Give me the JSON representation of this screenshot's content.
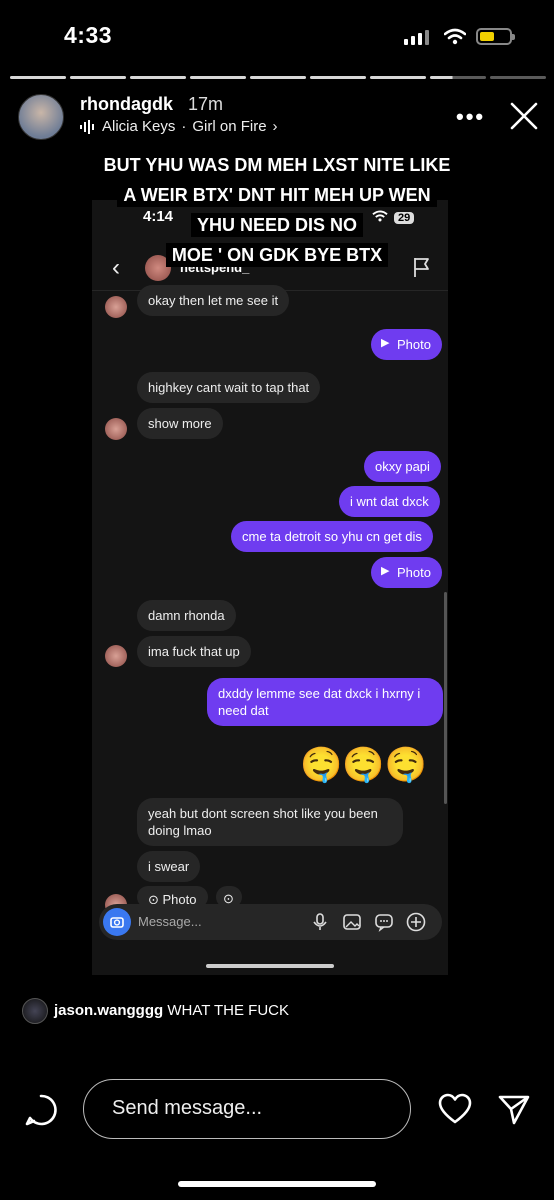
{
  "status": {
    "time": "4:33"
  },
  "story": {
    "username": "rhondagdk",
    "time_ago": "17m",
    "music_artist": "Alicia Keys",
    "music_sep": "·",
    "music_title": "Girl on Fire",
    "caption_lines": [
      "BUT YHU WAS DM MEH LXST NITE LIKE",
      "A WEIR BTX' DNT HIT MEH UP WEN",
      "YHU NEED DIS NO",
      "MOE ' ON GDK BYE BTX"
    ]
  },
  "inner_screenshot": {
    "status_time": "4:14",
    "battery": "29",
    "thread_name": "nettspend_",
    "messages": [
      {
        "side": "in",
        "text": "okay then let me see it"
      },
      {
        "side": "out",
        "text": "Photo",
        "type": "photo"
      },
      {
        "side": "in",
        "text": "highkey cant wait to tap that"
      },
      {
        "side": "in",
        "text": "show more"
      },
      {
        "side": "out",
        "text": "okxy papi"
      },
      {
        "side": "out",
        "text": "i wnt dat dxck"
      },
      {
        "side": "out",
        "text": "cme ta detroit so yhu cn get dis"
      },
      {
        "side": "out",
        "text": "Photo",
        "type": "photo"
      },
      {
        "side": "in",
        "text": "damn rhonda"
      },
      {
        "side": "in",
        "text": "ima fuck that up"
      },
      {
        "side": "out",
        "text": "dxddy lemme see dat dxck i hxrny i need dat"
      },
      {
        "side": "out",
        "text": "🤤🤤🤤",
        "type": "emoji"
      },
      {
        "side": "in",
        "text": "yeah but dont screen shot like you been doing lmao"
      },
      {
        "side": "in",
        "text": "i swear"
      },
      {
        "side": "in",
        "text": "Photo",
        "type": "photo"
      }
    ],
    "composer_placeholder": "Message..."
  },
  "comment": {
    "user": "jason.wangggg",
    "text": "WHAT THE FUCK"
  },
  "reply": {
    "placeholder": "Send message..."
  }
}
